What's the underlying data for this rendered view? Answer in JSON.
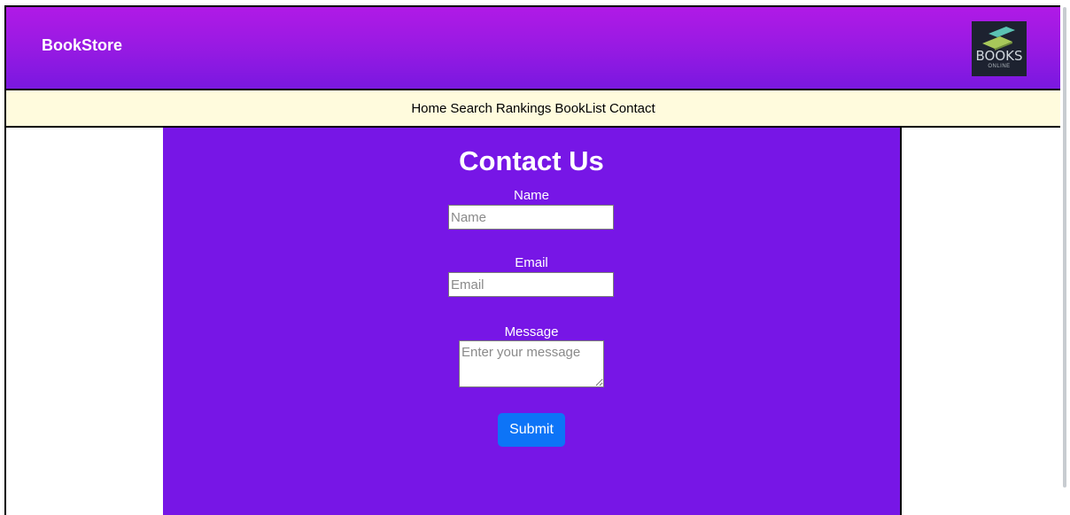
{
  "header": {
    "brand": "BookStore",
    "logo": {
      "title": "BOOKS",
      "subtitle": "ONLINE"
    }
  },
  "nav": {
    "items": [
      {
        "label": "Home"
      },
      {
        "label": "Search"
      },
      {
        "label": "Rankings"
      },
      {
        "label": "BookList"
      },
      {
        "label": "Contact"
      }
    ]
  },
  "contact_form": {
    "title": "Contact Us",
    "name_label": "Name",
    "name_placeholder": "Name",
    "email_label": "Email",
    "email_placeholder": "Email",
    "message_label": "Message",
    "message_placeholder": "Enter your message",
    "submit_label": "Submit"
  },
  "colors": {
    "header_gradient_top": "#b01ae6",
    "header_gradient_bottom": "#7a18e0",
    "nav_background": "#fffbdd",
    "panel_background": "#7716e6",
    "submit_background": "#0d74f7"
  }
}
